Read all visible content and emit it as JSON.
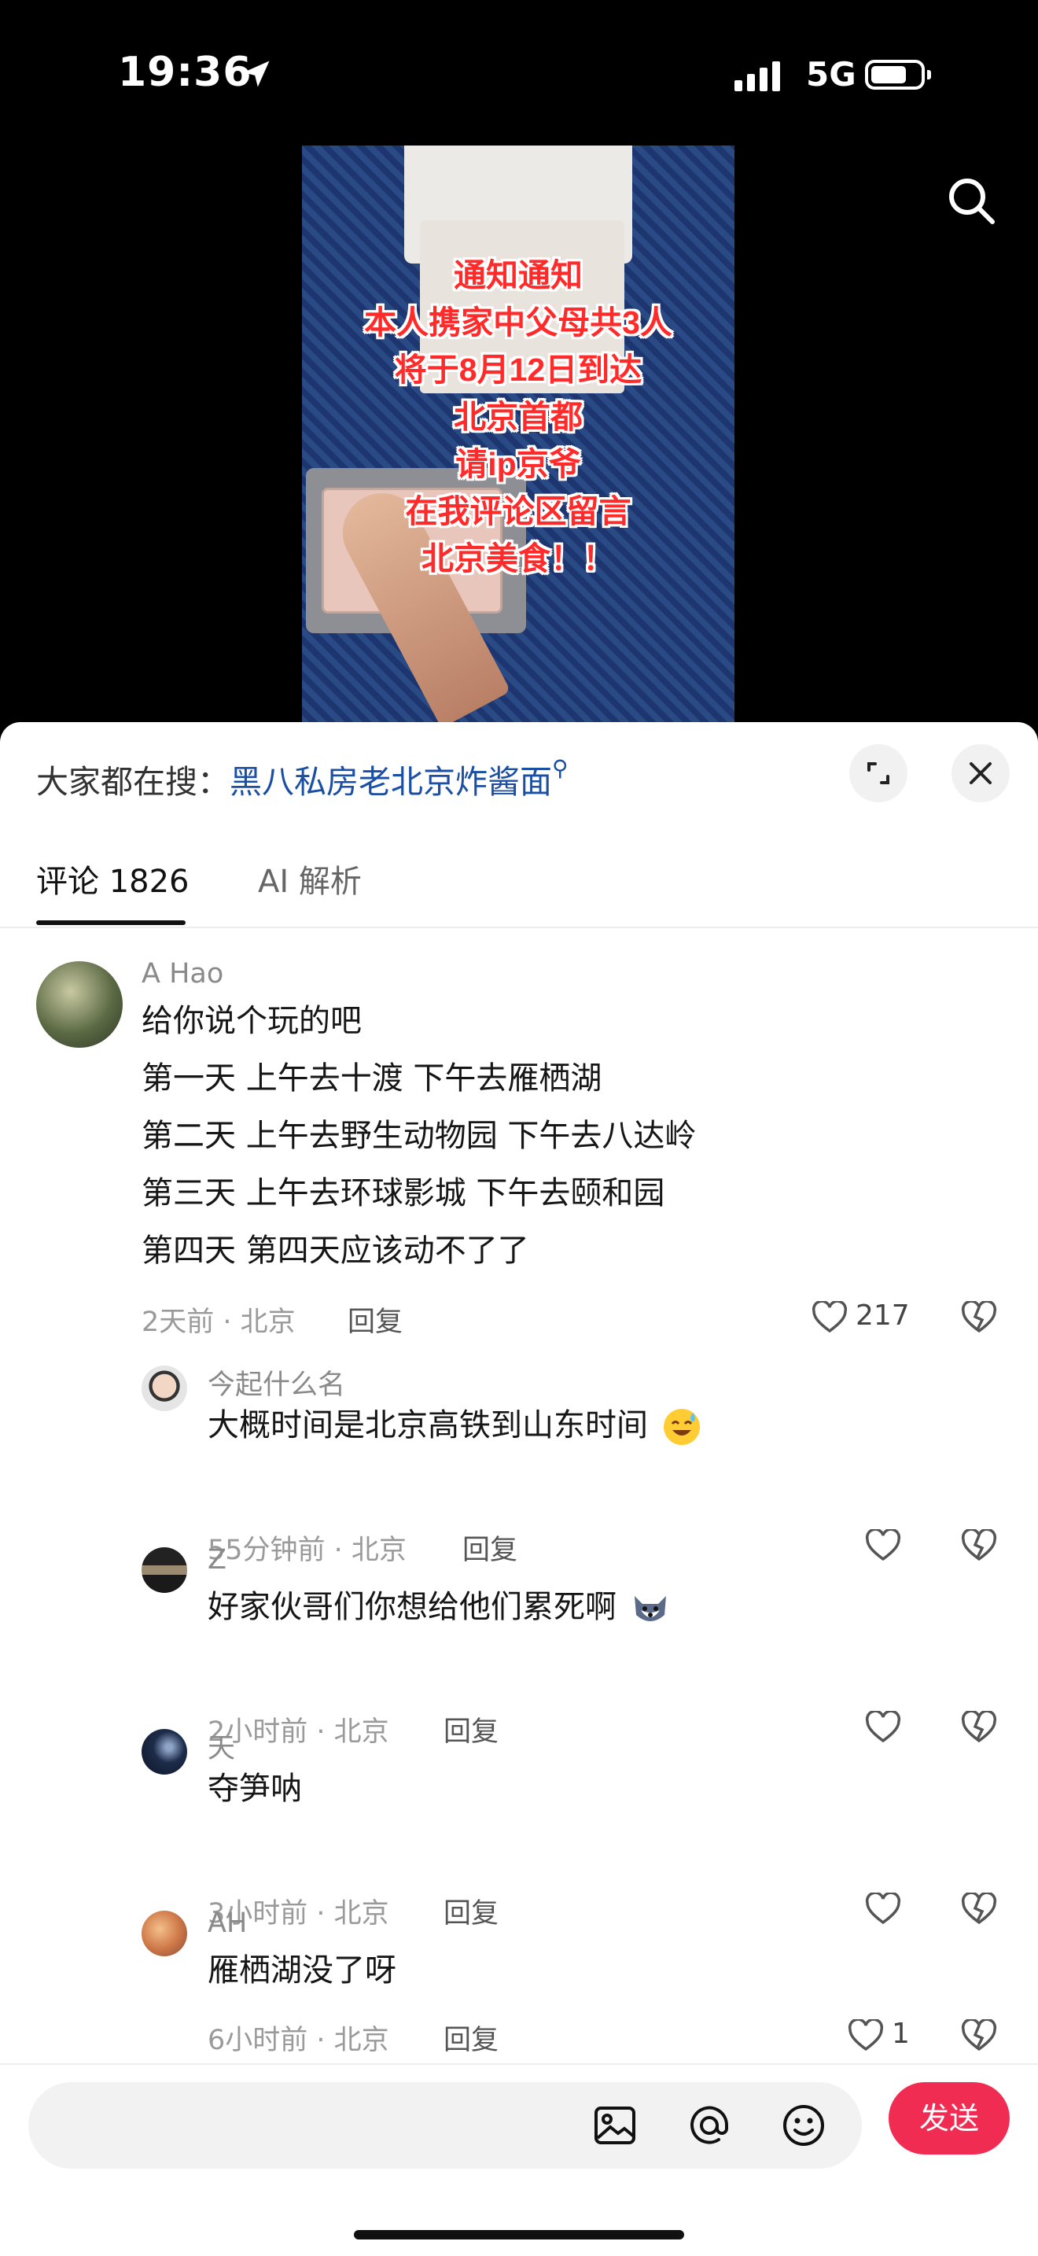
{
  "status_bar": {
    "time": "19:36",
    "network": "5G"
  },
  "video": {
    "overlay_lines": [
      "通知通知",
      "本人携家中父母共3人",
      "将于8月12日到达",
      "北京首都",
      "请ip京爷",
      "在我评论区留言",
      "北京美食！！"
    ]
  },
  "sheet": {
    "trending_prefix": "大家都在搜：",
    "trending_keyword": "黑八私房老北京炸酱面"
  },
  "tabs": {
    "comments_label": "评论 1826",
    "ai_label": "AI 解析"
  },
  "comments": [
    {
      "user": "A Hao",
      "lines": [
        "给你说个玩的吧",
        "第一天  上午去十渡  下午去雁栖湖",
        "第二天   上午去野生动物园   下午去八达岭",
        "第三天   上午去环球影城   下午去颐和园",
        "第四天  第四天应该动不了了"
      ],
      "meta": "2天前 · 北京",
      "reply": "回复",
      "likes": "217"
    },
    {
      "user": "今起什么名",
      "lines": [
        "大概时间是北京高铁到山东时间"
      ],
      "meta": "55分钟前 · 北京",
      "reply": "回复",
      "likes": ""
    },
    {
      "user": "Z",
      "lines": [
        "好家伙哥们你想给他们累死啊"
      ],
      "meta": "2小时前 · 北京",
      "reply": "回复",
      "likes": ""
    },
    {
      "user": "天",
      "lines": [
        "夺笋呐"
      ],
      "meta": "3小时前 · 北京",
      "reply": "回复",
      "likes": ""
    },
    {
      "user": "AH",
      "lines": [
        "雁栖湖没了呀"
      ],
      "meta": "6小时前 · 北京",
      "reply": "回复",
      "likes": "1"
    }
  ],
  "input_bar": {
    "send_label": "发送"
  },
  "colors": {
    "accent": "#f02c52",
    "keyword": "#1a4fa3",
    "overlay_text": "#ff2a2a"
  }
}
